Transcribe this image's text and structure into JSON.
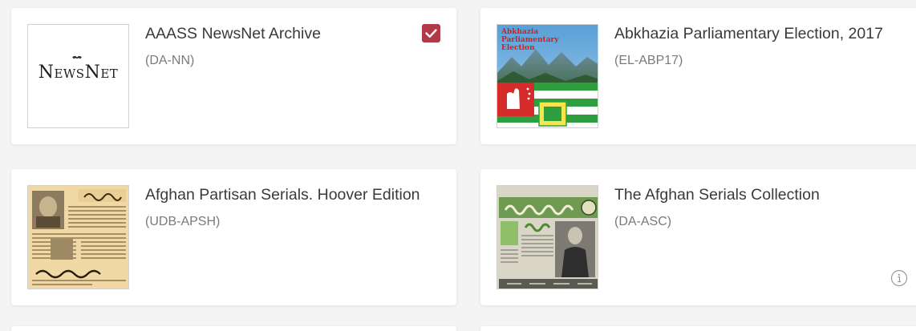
{
  "colors": {
    "accent": "#b03a48",
    "title": "#3a3a3a",
    "code": "#7a7a7a",
    "background": "#f4f4f5",
    "card": "#ffffff"
  },
  "cards": [
    {
      "title": "AAASS NewsNet Archive",
      "code": "(DA-NN)",
      "thumbnail_icon": "newsnet-logo",
      "logo_text": "NewsNet",
      "selected": true
    },
    {
      "title": "Abkhazia Parliamentary Election, 2017",
      "code": "(EL-ABP17)",
      "thumbnail_icon": "abkhazia-election-poster",
      "poster_text": "Abkhazia Parliamentary Election",
      "selected": false
    },
    {
      "title": "Afghan Partisan Serials. Hoover Edition",
      "code": "(UDB-APSH)",
      "thumbnail_icon": "afghan-newspaper-scan",
      "selected": false
    },
    {
      "title": "The Afghan Serials Collection",
      "code": "(DA-ASC)",
      "thumbnail_icon": "afghan-newspaper-cover",
      "selected": false,
      "info_icon": "info-icon"
    }
  ]
}
